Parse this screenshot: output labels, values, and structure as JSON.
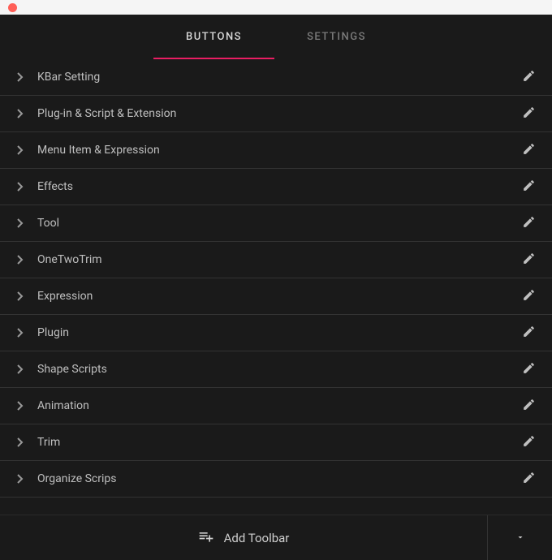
{
  "tabs": {
    "buttons": "BUTTONS",
    "settings": "SETTINGS"
  },
  "rows": [
    {
      "label": "KBar Setting"
    },
    {
      "label": "Plug-in & Script & Extension"
    },
    {
      "label": "Menu Item & Expression"
    },
    {
      "label": "Effects"
    },
    {
      "label": "Tool"
    },
    {
      "label": "OneTwoTrim"
    },
    {
      "label": "Expression"
    },
    {
      "label": "Plugin"
    },
    {
      "label": "Shape Scripts"
    },
    {
      "label": "Animation"
    },
    {
      "label": "Trim"
    },
    {
      "label": "Organize Scrips"
    }
  ],
  "footer": {
    "add_toolbar": "Add Toolbar"
  }
}
